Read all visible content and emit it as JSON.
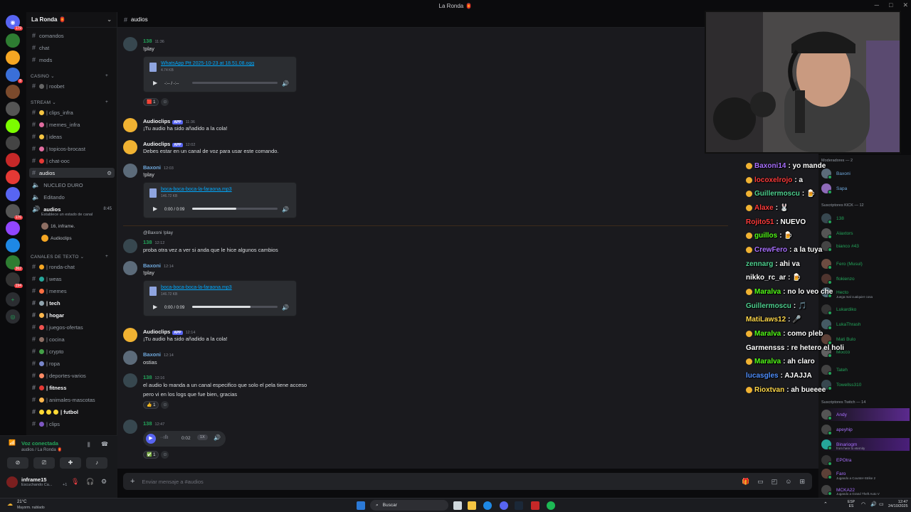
{
  "window": {
    "title": "La Ronda 🏮"
  },
  "server": {
    "name": "La Ronda 🏮"
  },
  "channels": {
    "top": [
      "comandos",
      "chat",
      "mods"
    ],
    "casino": {
      "label": "CASINO ⌄",
      "items": [
        "| roobet"
      ]
    },
    "stream": {
      "label": "STREAM ⌄",
      "items": [
        "| clips_infra",
        "| memes_infra",
        "| ideas",
        "| topicos-brocast",
        "| chat-ooc",
        "audios",
        "NUCLEO DURO",
        "Editando",
        "audios"
      ]
    },
    "voice_sub": "Establece un estado de canal",
    "voice_time": "8:45",
    "voice_users": [
      "16, inframe.",
      "Audioclips"
    ],
    "texto": {
      "label": "CANALES DE TEXTO ⌄",
      "items": [
        "| ronda-chat",
        "| weas",
        "| memes",
        "| tech",
        "| hogar",
        "| juegos-ofertas",
        "| cocina",
        "| crypto",
        "| ropa",
        "| deportes-varios",
        "| fitness",
        "| animales-mascotas",
        "| futbol",
        "| clips"
      ]
    }
  },
  "voice": {
    "status": "Voz conectada",
    "sub": "audios / La Ronda 🏮"
  },
  "user": {
    "name": "inframe15",
    "status": "Escuchando Ca...",
    "count": "+1"
  },
  "chat": {
    "channel": "audios",
    "placeholder": "Enviar mensaje a #audios",
    "messages": [
      {
        "author": "138",
        "time": "11:36",
        "text": "!play"
      },
      {
        "file": "WhatsApp Ptt 2025-10-23 at 18.51.08.ogg",
        "size": "4.74 KB",
        "time": "-:-- / -:--"
      },
      {
        "reaction": "1"
      },
      {
        "author": "Audioclips",
        "badge": "APP",
        "time": "11:36",
        "text": "¡Tu audio ha sido añadido a la cola!"
      },
      {
        "author": "Audioclips",
        "badge": "APP",
        "time": "12:02",
        "text": "Debes estar en un canal de voz para usar este comando."
      },
      {
        "author": "Baxoni",
        "time": "12:03",
        "text": "!play"
      },
      {
        "file": "boca-boca-boca-la-faraona.mp3",
        "size": "146.72 KB",
        "time": "0:00 / 0:09"
      },
      {
        "reply": "@Baxoni !play",
        "author": "138",
        "time": "12:12",
        "text": "proba otra vez a ver si anda que le hice algunos cambios"
      },
      {
        "author": "Baxoni",
        "time": "12:14",
        "text": "!play"
      },
      {
        "file": "boca-boca-boca-la-faraona.mp3",
        "size": "146.72 KB",
        "time": "0:00 / 0:09"
      },
      {
        "author": "Audioclips",
        "badge": "APP",
        "time": "12:14",
        "text": "¡Tu audio ha sido añadido a la cola!"
      },
      {
        "author": "Baxoni",
        "time": "12:14",
        "text": "ostias"
      },
      {
        "author": "138",
        "time": "12:16",
        "text": "el audio lo manda a un canal especifico que solo el pela tiene acceso",
        "text2": "pero vi en los logs que fue bien, gracias"
      },
      {
        "reaction": "1"
      },
      {
        "author": "138",
        "time": "12:47",
        "voice_time": "0:02",
        "speed": "1X"
      },
      {
        "reaction": "1"
      }
    ]
  },
  "members": {
    "mods_header": "Moderadores — 2",
    "mods": [
      "Baxoni",
      "Sapa"
    ],
    "kick_header": "Suscriptores KICK — 12",
    "kick": [
      "138",
      "Alaxtors",
      "bianco #43",
      "Fero (Musul)",
      "flokienzo",
      "Hecto",
      "Lukardiko",
      "LukaThrash",
      "Mati Bulo",
      "Mocco",
      "Tateh",
      "Towellss310"
    ],
    "kick_sub": "Juega mal cualquier cosa",
    "twitch_header": "Suscriptores Twitch — 14",
    "twitch": [
      "Andy",
      "apeyhip",
      "Binariogm",
      "EPOtra",
      "Faro",
      "MCKA22"
    ],
    "twitch_sub": "from here to eternity",
    "twitch_sub2": "Jugando a Counter-Strike 2",
    "twitch_sub3": "Jugando a Grand Theft Auto V"
  },
  "kick_chat": [
    {
      "user": "Baxoni14",
      "msg": ": yo mande",
      "color": "#a970ff"
    },
    {
      "user": "locoxelrojo",
      "msg": ": a",
      "color": "#ff3b3b"
    },
    {
      "user": "Guillermoscu",
      "msg": ": 🍺",
      "color": "#4fd190"
    },
    {
      "user": "Alaxe",
      "msg": ": 🐰",
      "color": "#ff3b3b"
    },
    {
      "user": "Rojito51",
      "msg": ": NUEVO",
      "color": "#ff3b3b"
    },
    {
      "user": "guillos",
      "msg": ": 🍺",
      "color": "#53fc18"
    },
    {
      "user": "CrewFero",
      "msg": ": a la tuya",
      "color": "#a970ff"
    },
    {
      "user": "zennarg",
      "msg": ": ahi va",
      "color": "#4fd190"
    },
    {
      "user": "nikko_rc_ar",
      "msg": ": 🍺",
      "color": "#ffffff"
    },
    {
      "user": "Maralva",
      "msg": ": no lo veo che",
      "color": "#53fc18"
    },
    {
      "user": "Guillermoscu",
      "msg": ": 🎵",
      "color": "#4fd190"
    },
    {
      "user": "MatiLaws12",
      "msg": ": 🎤",
      "color": "#ffd84a"
    },
    {
      "user": "Maralva",
      "msg": ": como pleb",
      "color": "#53fc18"
    },
    {
      "user": "Garmensss",
      "msg": ": re hetero el holi",
      "color": "#ffffff"
    },
    {
      "user": "Maralva",
      "msg": ": ah claro",
      "color": "#53fc18"
    },
    {
      "user": "lucasgles",
      "msg": ": AJAJJA",
      "color": "#4f8fff"
    },
    {
      "user": "Rioxtvan",
      "msg": ": ah bueeee",
      "color": "#ffd84a"
    }
  ],
  "taskbar": {
    "search": "Buscar",
    "weather_temp": "21°C",
    "weather_desc": "Mayorm. nublado",
    "lang": "ESP",
    "lang2": "ES",
    "time": "12:47",
    "date": "24/10/2025"
  }
}
